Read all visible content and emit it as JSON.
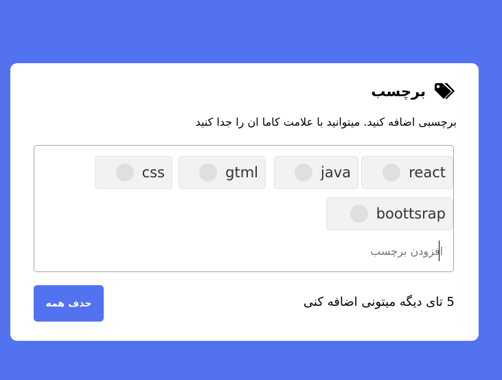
{
  "header": {
    "title": "برچسب",
    "icon": "tags-icon"
  },
  "subtitle": "برچسبی اضافه کنید. میتوانید با علامت کاما ان را جدا کنید",
  "tags": [
    {
      "label": "react"
    },
    {
      "label": "java"
    },
    {
      "label": "gtml"
    },
    {
      "label": "css"
    },
    {
      "label": "boottsrap"
    }
  ],
  "input": {
    "placeholder": "افزودن برچسب"
  },
  "footer": {
    "count_text": "5 تای دیگه میتونی اضافه کنی",
    "clear_label": "حذف همه"
  },
  "colors": {
    "background": "#5372f0",
    "card": "#ffffff",
    "button": "#5372f0",
    "chip_background": "#f2f2f2"
  }
}
